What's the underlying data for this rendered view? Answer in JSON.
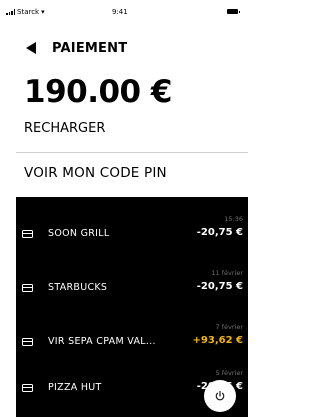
{
  "status_bar": {
    "carrier": "Starck",
    "time": "9:41"
  },
  "header": {
    "title": "PAIEMENT"
  },
  "balance": {
    "amount": "190.00 €"
  },
  "actions": {
    "recharge": "RECHARGER",
    "pin": "VOIR MON CODE PIN"
  },
  "transactions": [
    {
      "name": "SOON GRILL",
      "date": "15:36",
      "amount": "-20,75 €",
      "positive": false
    },
    {
      "name": "STARBUCKS",
      "date": "11 février",
      "amount": "-20,75 €",
      "positive": false
    },
    {
      "name": "VIR SEPA  CPAM VAL...",
      "date": "7 février",
      "amount": "+93,62 €",
      "positive": true
    },
    {
      "name": "PIZZA HUT",
      "date": "5 février",
      "amount": "-20,75 €",
      "positive": false
    }
  ],
  "colors": {
    "accent_positive": "#f2b705",
    "panel_bg": "#000000"
  },
  "icons": {
    "back": "back-arrow-icon",
    "transaction": "card-icon",
    "fab": "power-icon"
  }
}
